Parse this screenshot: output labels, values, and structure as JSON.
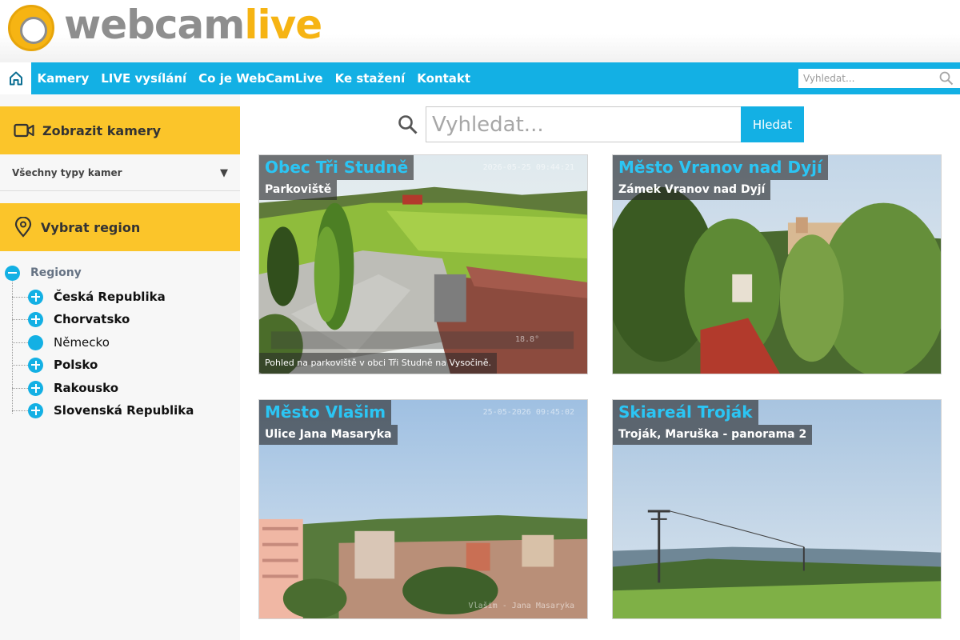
{
  "brand": {
    "part1": "webcam",
    "part2": "live"
  },
  "nav": {
    "items": [
      "Kamery",
      "LIVE vysílání",
      "Co je WebCamLive",
      "Ke stažení",
      "Kontakt"
    ],
    "search_placeholder": "Vyhledat..."
  },
  "sidebar": {
    "show_cameras": "Zobrazit kamery",
    "camera_type": "Všechny typy kamer",
    "select_region": "Vybrat region",
    "tree_root": "Regiony",
    "regions": [
      "Česká Republika",
      "Chorvatsko",
      "Německo",
      "Polsko",
      "Rakousko",
      "Slovenská Republika"
    ]
  },
  "main_search": {
    "placeholder": "Vyhledat...",
    "button": "Hledat"
  },
  "cameras": [
    {
      "title": "Obec Tři Studně",
      "subtitle": "Parkoviště",
      "description": "Pohled na parkoviště v obci Tři Studně na Vysočině.",
      "timestamp": "2026-05-25 09:44:21",
      "temp": "18.8°"
    },
    {
      "title": "Město Vranov nad Dyjí",
      "subtitle": "Zámek Vranov nad Dyjí"
    },
    {
      "title": "Město Vlašim",
      "subtitle": "Ulice Jana Masaryka",
      "timestamp": "25-05-2026 09:45:02",
      "watermark": "Vlašim - Jana Masaryka"
    },
    {
      "title": "Skiareál Troják",
      "subtitle": "Troják, Maruška - panorama 2"
    }
  ],
  "colors": {
    "accent": "#13b0e4",
    "yellow": "#fbc52a",
    "logo_gray": "#8e8e8e",
    "logo_yellow": "#f6b413"
  },
  "icons": [
    "home-icon",
    "search-icon",
    "video-camera-icon",
    "location-pin-icon",
    "chevron-down-icon",
    "expand-plus-icon",
    "collapse-minus-icon"
  ]
}
